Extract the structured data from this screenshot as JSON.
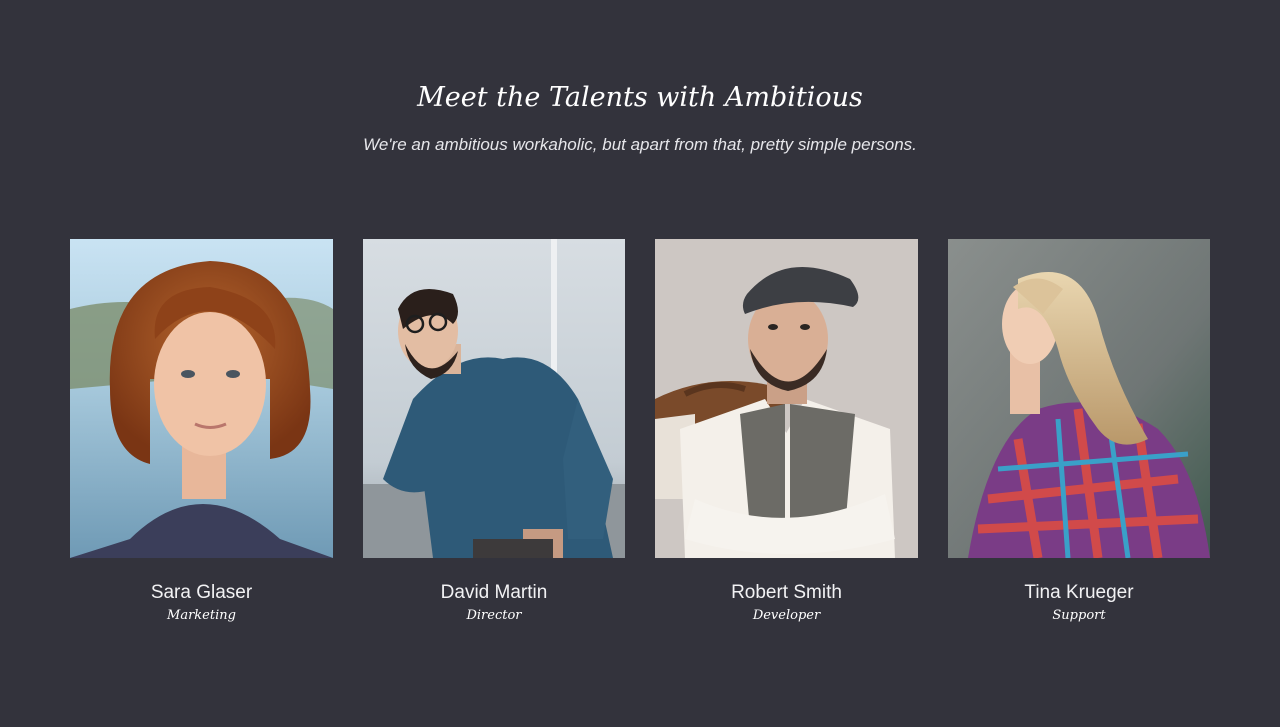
{
  "header": {
    "title": "Meet the Talents with Ambitious",
    "subtitle": "We're an ambitious workaholic, but apart from that, pretty simple persons."
  },
  "team": [
    {
      "name": "Sara Glaser",
      "role": "Marketing",
      "photo": "portrait-woman-red-hair"
    },
    {
      "name": "David Martin",
      "role": "Director",
      "photo": "portrait-man-glasses-denim"
    },
    {
      "name": "Robert Smith",
      "role": "Developer",
      "photo": "portrait-man-flat-cap-vest"
    },
    {
      "name": "Tina Krueger",
      "role": "Support",
      "photo": "portrait-woman-blonde-plaid"
    }
  ],
  "colors": {
    "background": "#33333c",
    "text": "#ffffff"
  }
}
